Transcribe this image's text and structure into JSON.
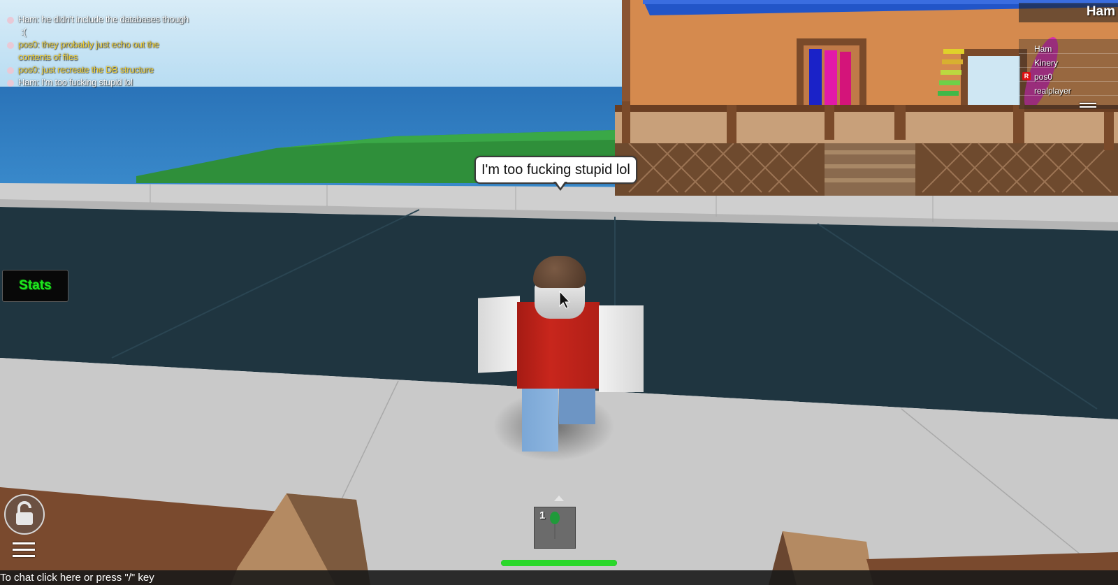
{
  "chat_log": [
    {
      "text": "Ham: he didn't include the databases though",
      "color": "white"
    },
    {
      "text": ":(",
      "color": "white",
      "continuation": true
    },
    {
      "text": "pos0: they probably just echo out the",
      "color": "yellow"
    },
    {
      "text": "contents of files",
      "color": "yellow",
      "continuation": true
    },
    {
      "text": "pos0: just recreate the DB structure",
      "color": "yellow"
    },
    {
      "text": "Ham: I'm too fucking stupid lol",
      "color": "white"
    }
  ],
  "speech_bubble": {
    "text": "I'm too fucking stupid lol"
  },
  "stats_button": {
    "label": "Stats"
  },
  "player_list": {
    "title": "Ham",
    "players": [
      "Ham",
      "Kinery",
      "pos0",
      "realplayer"
    ],
    "admin_badge_player": "pos0"
  },
  "hotbar": {
    "slots": [
      {
        "number": "1",
        "item_icon": "green-balloon-icon"
      }
    ]
  },
  "health": {
    "fraction": 1.0,
    "color": "#2bd82b"
  },
  "chat_bar": {
    "placeholder": "To chat click here or press \"/\" key"
  },
  "colors": {
    "stats_text": "#1ee81e",
    "chat_white": "#ffffff",
    "chat_yellow": "#f2d23a",
    "shirt": "#c8261c",
    "pants": "#7ba7d6"
  },
  "icons": {
    "lock": "unlocked-padlock-icon",
    "menu": "hamburger-menu-icon",
    "backpack_toggle": "caret-up-icon",
    "player_list_toggle": "collapse-lines-icon",
    "admin": "admin-badge-icon"
  }
}
